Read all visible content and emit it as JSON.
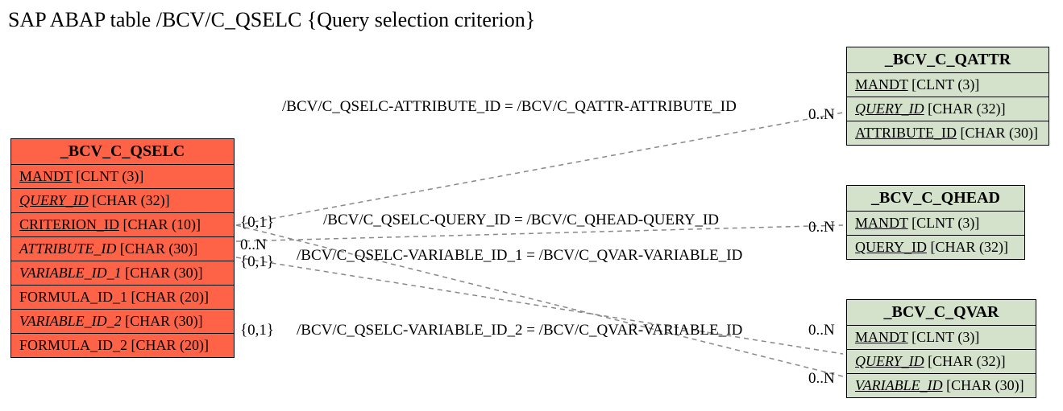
{
  "title": "SAP ABAP table /BCV/C_QSELC {Query selection criterion}",
  "tables": {
    "qselc": {
      "header": "_BCV_C_QSELC",
      "rows": [
        {
          "name": "MANDT",
          "type": "[CLNT (3)]",
          "ul": true,
          "it": false
        },
        {
          "name": "QUERY_ID",
          "type": "[CHAR (32)]",
          "ul": true,
          "it": true
        },
        {
          "name": "CRITERION_ID",
          "type": "[CHAR (10)]",
          "ul": true,
          "it": false
        },
        {
          "name": "ATTRIBUTE_ID",
          "type": "[CHAR (30)]",
          "ul": false,
          "it": true
        },
        {
          "name": "VARIABLE_ID_1",
          "type": "[CHAR (30)]",
          "ul": false,
          "it": true
        },
        {
          "name": "FORMULA_ID_1",
          "type": "[CHAR (20)]",
          "ul": false,
          "it": false
        },
        {
          "name": "VARIABLE_ID_2",
          "type": "[CHAR (30)]",
          "ul": false,
          "it": true
        },
        {
          "name": "FORMULA_ID_2",
          "type": "[CHAR (20)]",
          "ul": false,
          "it": false
        }
      ]
    },
    "qattr": {
      "header": "_BCV_C_QATTR",
      "rows": [
        {
          "name": "MANDT",
          "type": "[CLNT (3)]",
          "ul": true,
          "it": false
        },
        {
          "name": "QUERY_ID",
          "type": "[CHAR (32)]",
          "ul": true,
          "it": true
        },
        {
          "name": "ATTRIBUTE_ID",
          "type": "[CHAR (30)]",
          "ul": true,
          "it": false
        }
      ]
    },
    "qhead": {
      "header": "_BCV_C_QHEAD",
      "rows": [
        {
          "name": "MANDT",
          "type": "[CLNT (3)]",
          "ul": true,
          "it": false
        },
        {
          "name": "QUERY_ID",
          "type": "[CHAR (32)]",
          "ul": true,
          "it": false
        }
      ]
    },
    "qvar": {
      "header": "_BCV_C_QVAR",
      "rows": [
        {
          "name": "MANDT",
          "type": "[CLNT (3)]",
          "ul": true,
          "it": false
        },
        {
          "name": "QUERY_ID",
          "type": "[CHAR (32)]",
          "ul": true,
          "it": true
        },
        {
          "name": "VARIABLE_ID",
          "type": "[CHAR (30)]",
          "ul": true,
          "it": true
        }
      ]
    }
  },
  "relations": {
    "r1": "/BCV/C_QSELC-ATTRIBUTE_ID = /BCV/C_QATTR-ATTRIBUTE_ID",
    "r2": "/BCV/C_QSELC-QUERY_ID = /BCV/C_QHEAD-QUERY_ID",
    "r3": "/BCV/C_QSELC-VARIABLE_ID_1 = /BCV/C_QVAR-VARIABLE_ID",
    "r4": "/BCV/C_QSELC-VARIABLE_ID_2 = /BCV/C_QVAR-VARIABLE_ID"
  },
  "card": {
    "c1": "{0,1}",
    "c2": "0..N",
    "c3": "{0,1}",
    "c4": "{0,1}",
    "m1": "0..N",
    "m2": "0..N",
    "m3": "0..N",
    "m4": "0..N"
  }
}
